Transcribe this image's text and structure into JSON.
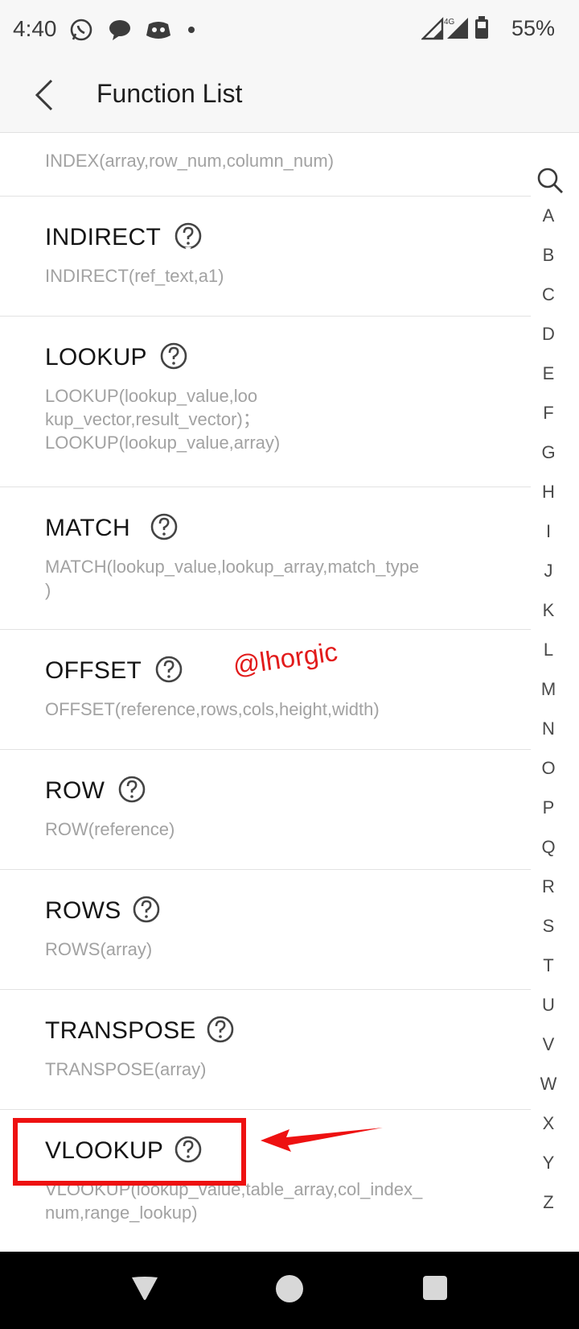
{
  "status_bar": {
    "time": "4:40",
    "battery": "55%",
    "network": "4G"
  },
  "header": {
    "title": "Function List"
  },
  "functions": [
    {
      "name": "",
      "syntax": "INDEX(array,row_num,column_num)"
    },
    {
      "name": "INDIRECT",
      "syntax": "INDIRECT(ref_text,a1)"
    },
    {
      "name": "LOOKUP",
      "syntax": "LOOKUP(lookup_value,loo\nkup_vector,result_vector)；\nLOOKUP(lookup_value,array)"
    },
    {
      "name": "MATCH",
      "syntax": "MATCH(lookup_value,lookup_array,match_type\n)"
    },
    {
      "name": "OFFSET",
      "syntax": "OFFSET(reference,rows,cols,height,width)"
    },
    {
      "name": "ROW",
      "syntax": "ROW(reference)"
    },
    {
      "name": "ROWS",
      "syntax": "ROWS(array)"
    },
    {
      "name": "TRANSPOSE",
      "syntax": "TRANSPOSE(array)"
    },
    {
      "name": "VLOOKUP",
      "syntax": "VLOOKUP(lookup_value,table_array,col_index_\nnum,range_lookup)"
    }
  ],
  "alphabet": [
    "A",
    "B",
    "C",
    "D",
    "E",
    "F",
    "G",
    "H",
    "I",
    "J",
    "K",
    "L",
    "M",
    "N",
    "O",
    "P",
    "Q",
    "R",
    "S",
    "T",
    "U",
    "V",
    "W",
    "X",
    "Y",
    "Z"
  ],
  "annotation": {
    "watermark": "@lhorgic",
    "color": "#e21b1b"
  },
  "icons": {
    "back": "chevron-left-icon",
    "help": "question-circle-icon",
    "search": "search-icon"
  }
}
